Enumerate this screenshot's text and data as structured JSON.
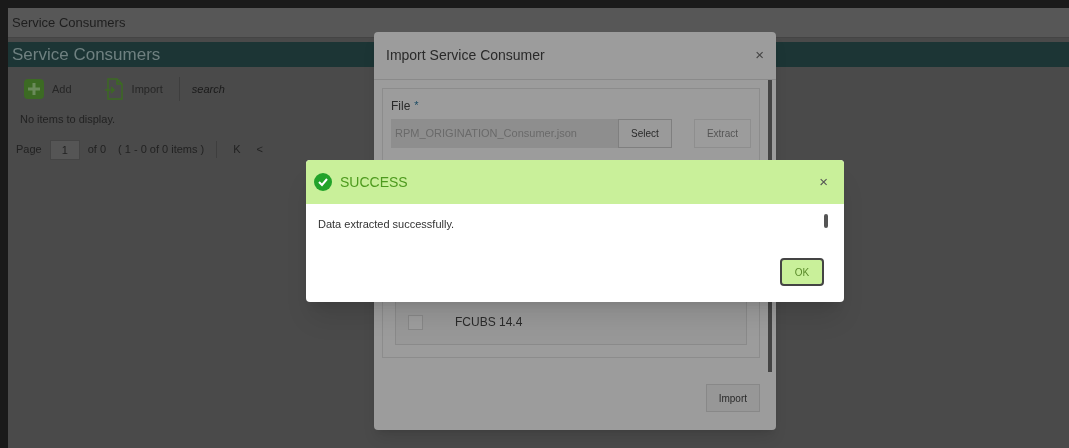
{
  "window": {
    "title": "Service Consumers"
  },
  "header": {
    "title": "Service Consumers"
  },
  "toolbar": {
    "add": "Add",
    "import": "Import",
    "search": {
      "placeholder": "search"
    }
  },
  "empty_text": "No items to display.",
  "pager": {
    "page_label": "Page",
    "page_value": "1",
    "of": "of 0",
    "items": "( 1 - 0 of 0 items )",
    "first": "K",
    "prev": "<"
  },
  "import_dialog": {
    "title": "Import Service Consumer",
    "close": "×",
    "file_label": "File",
    "required": "*",
    "file_value": "RPM_ORIGINATION_Consumer.json",
    "select": "Select",
    "extract": "Extract",
    "extract_disabled": true,
    "rows": [
      {
        "label": "FCUBS 14.4",
        "checked": false
      }
    ],
    "import": "Import"
  },
  "success_dialog": {
    "title": "SUCCESS",
    "close": "×",
    "message": "Data extracted successfully.",
    "ok": "OK"
  }
}
